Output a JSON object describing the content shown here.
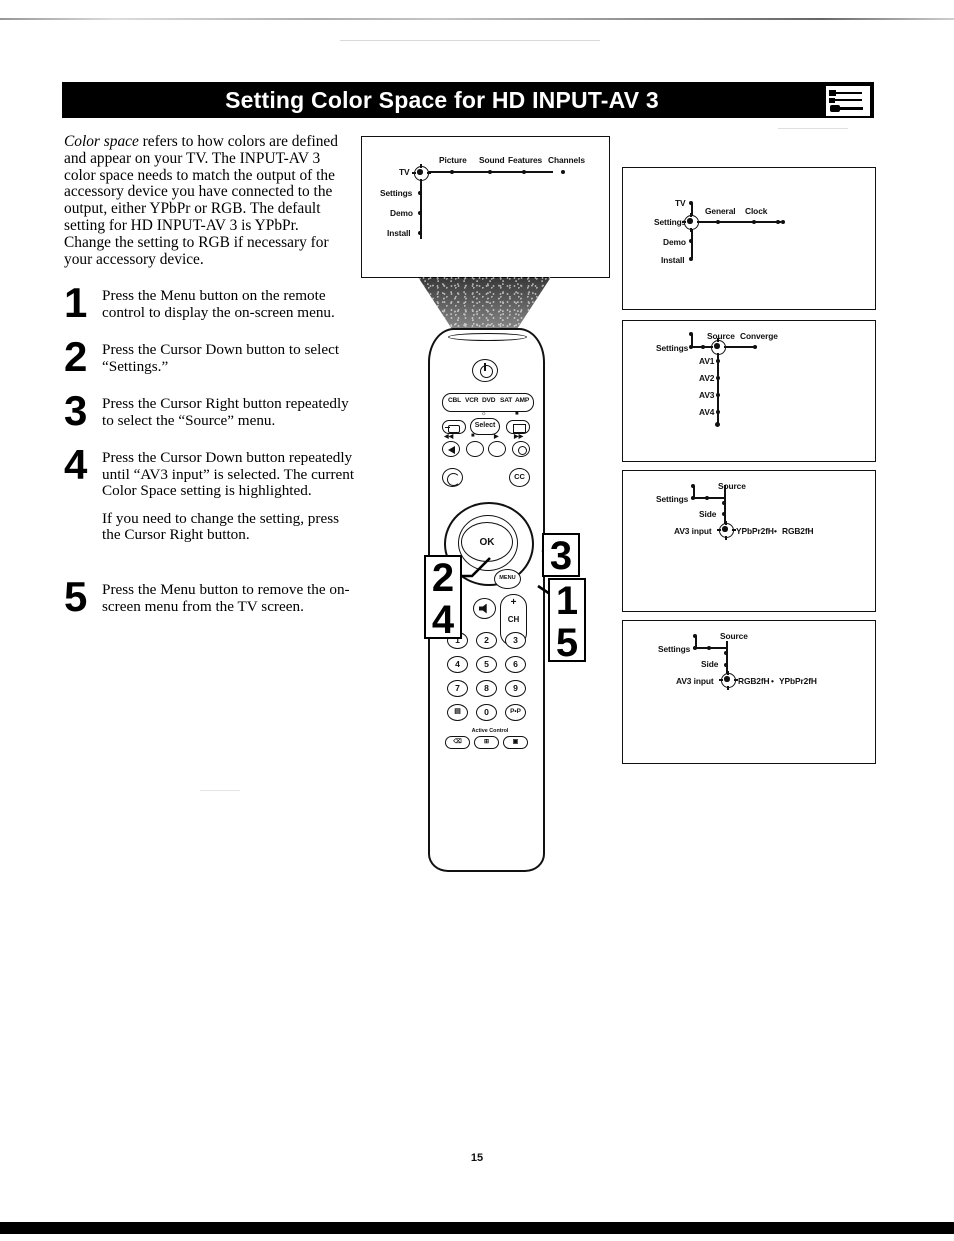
{
  "header": {
    "title": "Setting Color Space for HD INPUT-AV 3",
    "icon": "cable-connector-icon"
  },
  "intro": {
    "emphasis": "Color space",
    "text": " refers to how colors are defined and appear on your TV. The INPUT-AV 3 color space needs to match the output of the accessory device you have connected to the output, either YPbPr or RGB. The default setting for HD INPUT-AV 3 is YPbPr. Change the setting to RGB if necessary for your accessory device."
  },
  "steps": [
    {
      "number": "1",
      "paragraphs": [
        "Press the Menu button on the remote control to display the on-screen menu."
      ]
    },
    {
      "number": "2",
      "paragraphs": [
        "Press the Cursor Down button to select “Settings.”"
      ]
    },
    {
      "number": "3",
      "paragraphs": [
        "Press the Cursor Right button repeatedly to select the “Source” menu."
      ]
    },
    {
      "number": "4",
      "paragraphs": [
        "Press the Cursor Down button repeatedly until “AV3 input” is selected. The current Color Space setting is highlighted.",
        "If you need to change the setting, press the Cursor Right button."
      ]
    },
    {
      "number": "5",
      "paragraphs": [
        "Press the Menu button to remove the on-screen menu from the TV screen."
      ]
    }
  ],
  "tv_screen": {
    "vertical_items": [
      "TV",
      "Settings",
      "Demo",
      "Install"
    ],
    "horizontal_items": [
      "Picture",
      "Sound",
      "Features",
      "Channels"
    ],
    "cursor_on": "TV"
  },
  "panels": [
    {
      "name": "settings-menu-panel",
      "vertical_items": [
        "TV",
        "Settings",
        "Demo",
        "Install"
      ],
      "horizontal_items": [
        "General",
        "Clock"
      ],
      "cursor_on": "Settings"
    },
    {
      "name": "source-menu-panel",
      "root_label": "Settings",
      "horizontal_items": [
        "Source",
        "Converge"
      ],
      "vertical_items": [
        "AV1",
        "AV2",
        "AV3",
        "AV4"
      ],
      "cursor_on": "Source"
    },
    {
      "name": "av3-ypbpr-panel",
      "root_label": "Settings",
      "horizontal_items": [
        "Source"
      ],
      "vertical_items": [
        "Side",
        "AV3 input"
      ],
      "options": [
        "YPbPr2fH",
        "RGB2fH"
      ],
      "separator": "•",
      "cursor_on": "AV3 input"
    },
    {
      "name": "av3-rgb-panel",
      "root_label": "Settings",
      "horizontal_items": [
        "Source"
      ],
      "vertical_items": [
        "Side",
        "AV3 input"
      ],
      "options": [
        "RGB2fH",
        "YPbPr2fH"
      ],
      "separator": "•",
      "cursor_on": "AV3 input"
    }
  ],
  "remote": {
    "power_icon": "power-icon",
    "mode_buttons": [
      "CBL",
      "VCR",
      "DVD",
      "SAT",
      "AMP"
    ],
    "select_label": "Select",
    "ok_label": "OK",
    "cc_label": "CC",
    "ch_plus": "+",
    "ch_label": "CH",
    "ch_minus": "−",
    "menu_label": "MENU",
    "mute_icon": "mute-icon",
    "source_icon": "source-input-icon",
    "pip_icon": "pip-icon",
    "surf_icon": "surf-icon",
    "keypad": [
      "1",
      "2",
      "3",
      "4",
      "5",
      "6",
      "7",
      "8",
      "9",
      "▤",
      "0",
      "P•P"
    ],
    "active_control_label": "Active Control",
    "bottom_buttons": [
      "⌫",
      "⊞",
      "▣"
    ],
    "transport_labels": [
      "◀◀",
      "■",
      "▶",
      "▶▶"
    ]
  },
  "callouts": [
    {
      "name": "callout-2-4",
      "lines": [
        "2",
        "4"
      ]
    },
    {
      "name": "callout-3",
      "lines": [
        "3"
      ]
    },
    {
      "name": "callout-1-5",
      "lines": [
        "1",
        "5"
      ]
    }
  ],
  "page_number": "15"
}
